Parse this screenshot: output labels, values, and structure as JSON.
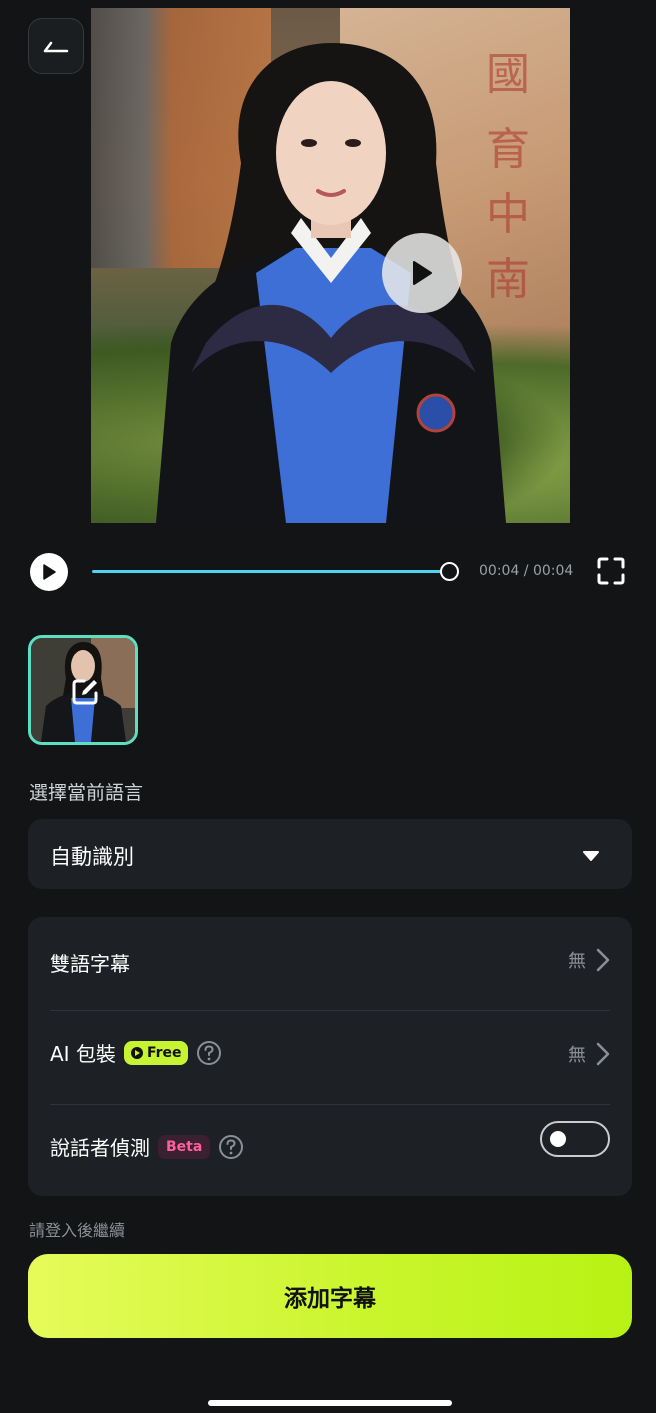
{
  "player": {
    "time": "00:04 / 00:04",
    "progress": 1.0
  },
  "video": {
    "wall_text": [
      "國",
      "育",
      "中",
      "南"
    ]
  },
  "language": {
    "label": "選擇當前語言",
    "selected": "自動識別"
  },
  "options": {
    "bilingual": {
      "label": "雙語字幕",
      "value": "無"
    },
    "ai_pack": {
      "label": "AI 包裝",
      "badge": "Free",
      "value": "無"
    },
    "speaker": {
      "label": "說話者偵測",
      "badge": "Beta",
      "toggle_on": false
    }
  },
  "hint": "請登入後繼續",
  "cta": "添加字幕",
  "colors": {
    "accent": "#c6f432",
    "progress": "#4fd3ee",
    "thumb_border": "#5ee0c0",
    "beta": "#ff5fa0"
  },
  "icons": [
    "back-icon",
    "play-icon",
    "fullscreen-icon",
    "edit-icon",
    "caret-down-icon",
    "chevron-right-icon",
    "help-icon"
  ]
}
